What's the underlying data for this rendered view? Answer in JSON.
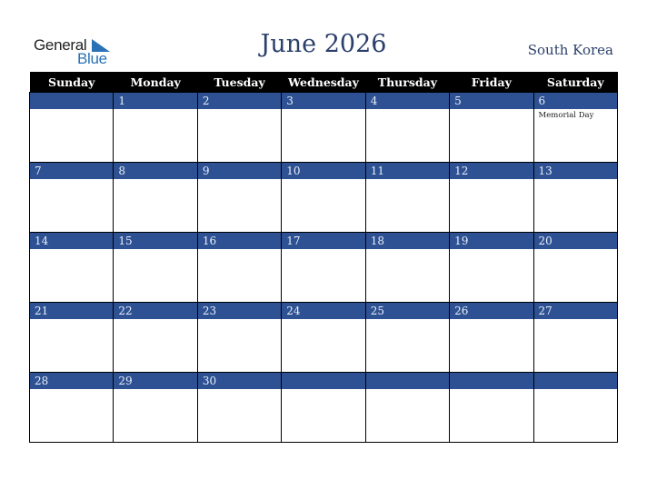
{
  "logo": {
    "word1": "General",
    "word2": "Blue"
  },
  "header": {
    "title": "June 2026",
    "country": "South Korea"
  },
  "colors": {
    "header_bg": "#000000",
    "strip_bg": "#2d5193",
    "title": "#2b3f6b",
    "logo_blue": "#2a72b5"
  },
  "weekdays": [
    "Sunday",
    "Monday",
    "Tuesday",
    "Wednesday",
    "Thursday",
    "Friday",
    "Saturday"
  ],
  "weeks": [
    [
      {
        "day": "",
        "event": ""
      },
      {
        "day": "1",
        "event": ""
      },
      {
        "day": "2",
        "event": ""
      },
      {
        "day": "3",
        "event": ""
      },
      {
        "day": "4",
        "event": ""
      },
      {
        "day": "5",
        "event": ""
      },
      {
        "day": "6",
        "event": "Memorial Day"
      }
    ],
    [
      {
        "day": "7",
        "event": ""
      },
      {
        "day": "8",
        "event": ""
      },
      {
        "day": "9",
        "event": ""
      },
      {
        "day": "10",
        "event": ""
      },
      {
        "day": "11",
        "event": ""
      },
      {
        "day": "12",
        "event": ""
      },
      {
        "day": "13",
        "event": ""
      }
    ],
    [
      {
        "day": "14",
        "event": ""
      },
      {
        "day": "15",
        "event": ""
      },
      {
        "day": "16",
        "event": ""
      },
      {
        "day": "17",
        "event": ""
      },
      {
        "day": "18",
        "event": ""
      },
      {
        "day": "19",
        "event": ""
      },
      {
        "day": "20",
        "event": ""
      }
    ],
    [
      {
        "day": "21",
        "event": ""
      },
      {
        "day": "22",
        "event": ""
      },
      {
        "day": "23",
        "event": ""
      },
      {
        "day": "24",
        "event": ""
      },
      {
        "day": "25",
        "event": ""
      },
      {
        "day": "26",
        "event": ""
      },
      {
        "day": "27",
        "event": ""
      }
    ],
    [
      {
        "day": "28",
        "event": ""
      },
      {
        "day": "29",
        "event": ""
      },
      {
        "day": "30",
        "event": ""
      },
      {
        "day": "",
        "event": ""
      },
      {
        "day": "",
        "event": ""
      },
      {
        "day": "",
        "event": ""
      },
      {
        "day": "",
        "event": ""
      }
    ]
  ]
}
